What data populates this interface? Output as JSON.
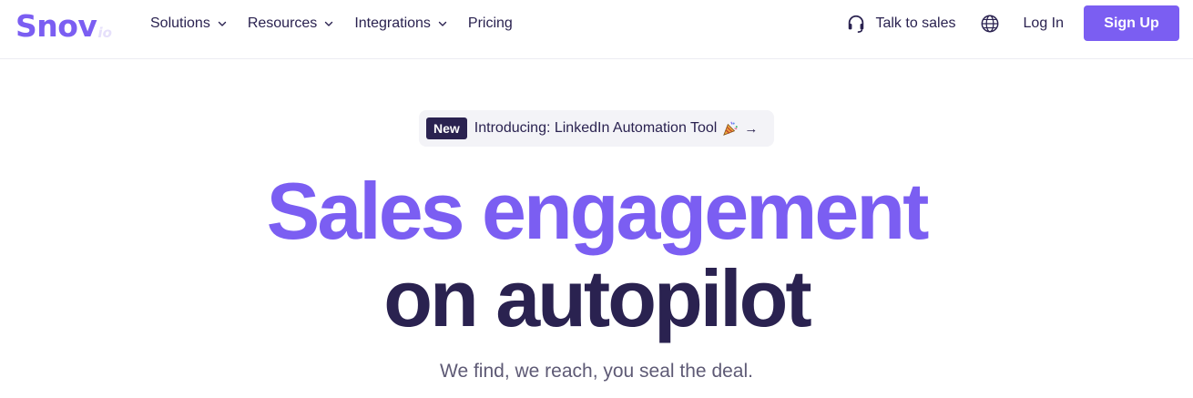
{
  "brand": {
    "name": "Snov",
    "suffix": "io",
    "color": "#7b5ef2",
    "ink": "#2a2250"
  },
  "nav": {
    "links": [
      {
        "label": "Solutions",
        "has_dropdown": true
      },
      {
        "label": "Resources",
        "has_dropdown": true
      },
      {
        "label": "Integrations",
        "has_dropdown": true
      },
      {
        "label": "Pricing",
        "has_dropdown": false
      }
    ],
    "talk_to_sales": "Talk to sales",
    "talk_icon": "headset-icon",
    "language_icon": "globe-icon",
    "login": "Log In",
    "signup": "Sign Up"
  },
  "announcement": {
    "badge": "New",
    "text": "Introducing: LinkedIn Automation Tool",
    "emoji_icon": "party-popper-icon",
    "arrow": "→"
  },
  "hero": {
    "line1": "Sales engagement",
    "line2": "on autopilot",
    "subtitle": "We find, we reach, you seal the deal."
  }
}
